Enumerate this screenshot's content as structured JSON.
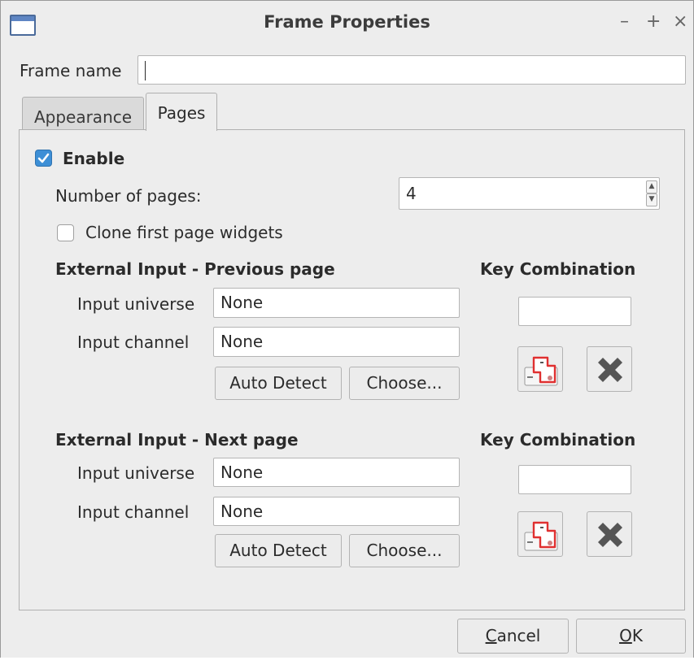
{
  "window": {
    "title": "Frame Properties",
    "minimize": "–",
    "maximize": "+",
    "close": "×"
  },
  "frame_name": {
    "label": "Frame name",
    "value": ""
  },
  "tabs": [
    {
      "label": "Appearance",
      "active": false
    },
    {
      "label": "Pages",
      "active": true
    }
  ],
  "pages": {
    "enable": {
      "label": "Enable",
      "checked": true
    },
    "num_pages": {
      "label": "Number of pages:",
      "value": "4"
    },
    "clone": {
      "label": "Clone first page widgets",
      "checked": false
    },
    "previous": {
      "heading": "External Input - Previous page",
      "universe_label": "Input universe",
      "universe_value": "None",
      "channel_label": "Input channel",
      "channel_value": "None",
      "auto_detect": "Auto Detect",
      "choose": "Choose...",
      "key_heading": "Key Combination",
      "key_value": ""
    },
    "next": {
      "heading": "External Input - Next page",
      "universe_label": "Input universe",
      "universe_value": "None",
      "channel_label": "Input channel",
      "channel_value": "None",
      "auto_detect": "Auto Detect",
      "choose": "Choose...",
      "key_heading": "Key Combination",
      "key_value": ""
    }
  },
  "buttons": {
    "cancel_first": "C",
    "cancel_rest": "ancel",
    "ok_first": "O",
    "ok_rest": "K"
  },
  "icons": {
    "attach": "key-attach-icon",
    "remove": "key-remove-icon"
  },
  "colors": {
    "accent": "#3d8fd6",
    "attach_red": "#e03030",
    "remove_gray": "#555555"
  }
}
